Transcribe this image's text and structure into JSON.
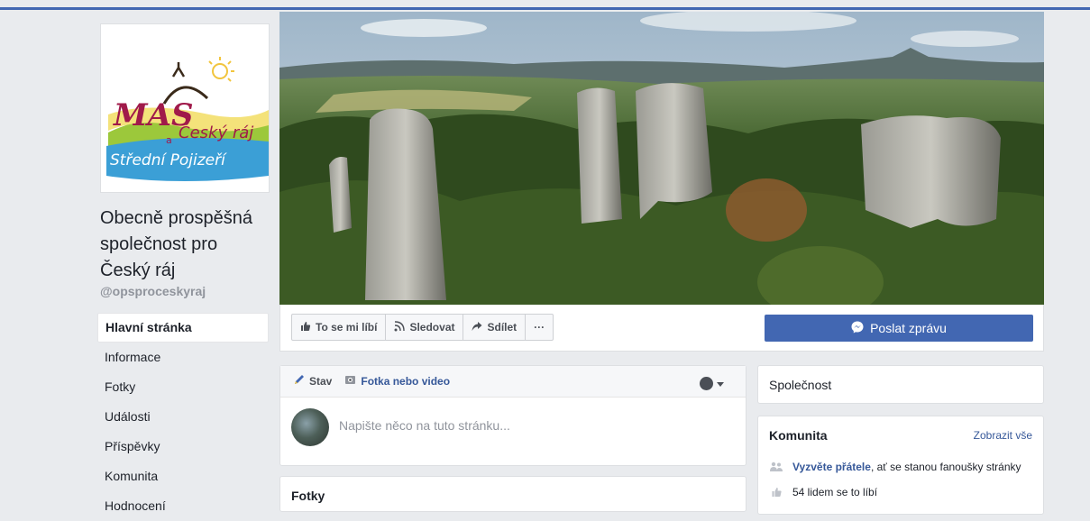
{
  "page": {
    "name": "Obecně prospěšná společnost pro Český ráj",
    "handle": "@opsproceskyraj",
    "logo_text": {
      "line1": "MAS",
      "line2": "Český ráj",
      "line3": "a",
      "line4": "Střední Pojizeří"
    }
  },
  "nav": {
    "items": [
      {
        "label": "Hlavní stránka",
        "active": true
      },
      {
        "label": "Informace"
      },
      {
        "label": "Fotky"
      },
      {
        "label": "Události"
      },
      {
        "label": "Příspěvky"
      },
      {
        "label": "Komunita"
      },
      {
        "label": "Hodnocení"
      }
    ]
  },
  "actions": {
    "like": "To se mi líbí",
    "follow": "Sledovat",
    "share": "Sdílet",
    "more": "···",
    "send_message": "Poslat zprávu"
  },
  "composer": {
    "tab_status": "Stav",
    "tab_photo": "Fotka nebo video",
    "placeholder": "Napište něco na tuto stránku..."
  },
  "photos": {
    "title": "Fotky"
  },
  "category": {
    "label": "Společnost"
  },
  "community": {
    "title": "Komunita",
    "see_all": "Zobrazit vše",
    "invite_link": "Vyzvěte přátele",
    "invite_rest": ", ať se stanou fanoušky stránky",
    "likes": "54 lidem se to líbí"
  },
  "colors": {
    "brand": "#4267b2",
    "link": "#365899",
    "background": "#e9ebee"
  }
}
